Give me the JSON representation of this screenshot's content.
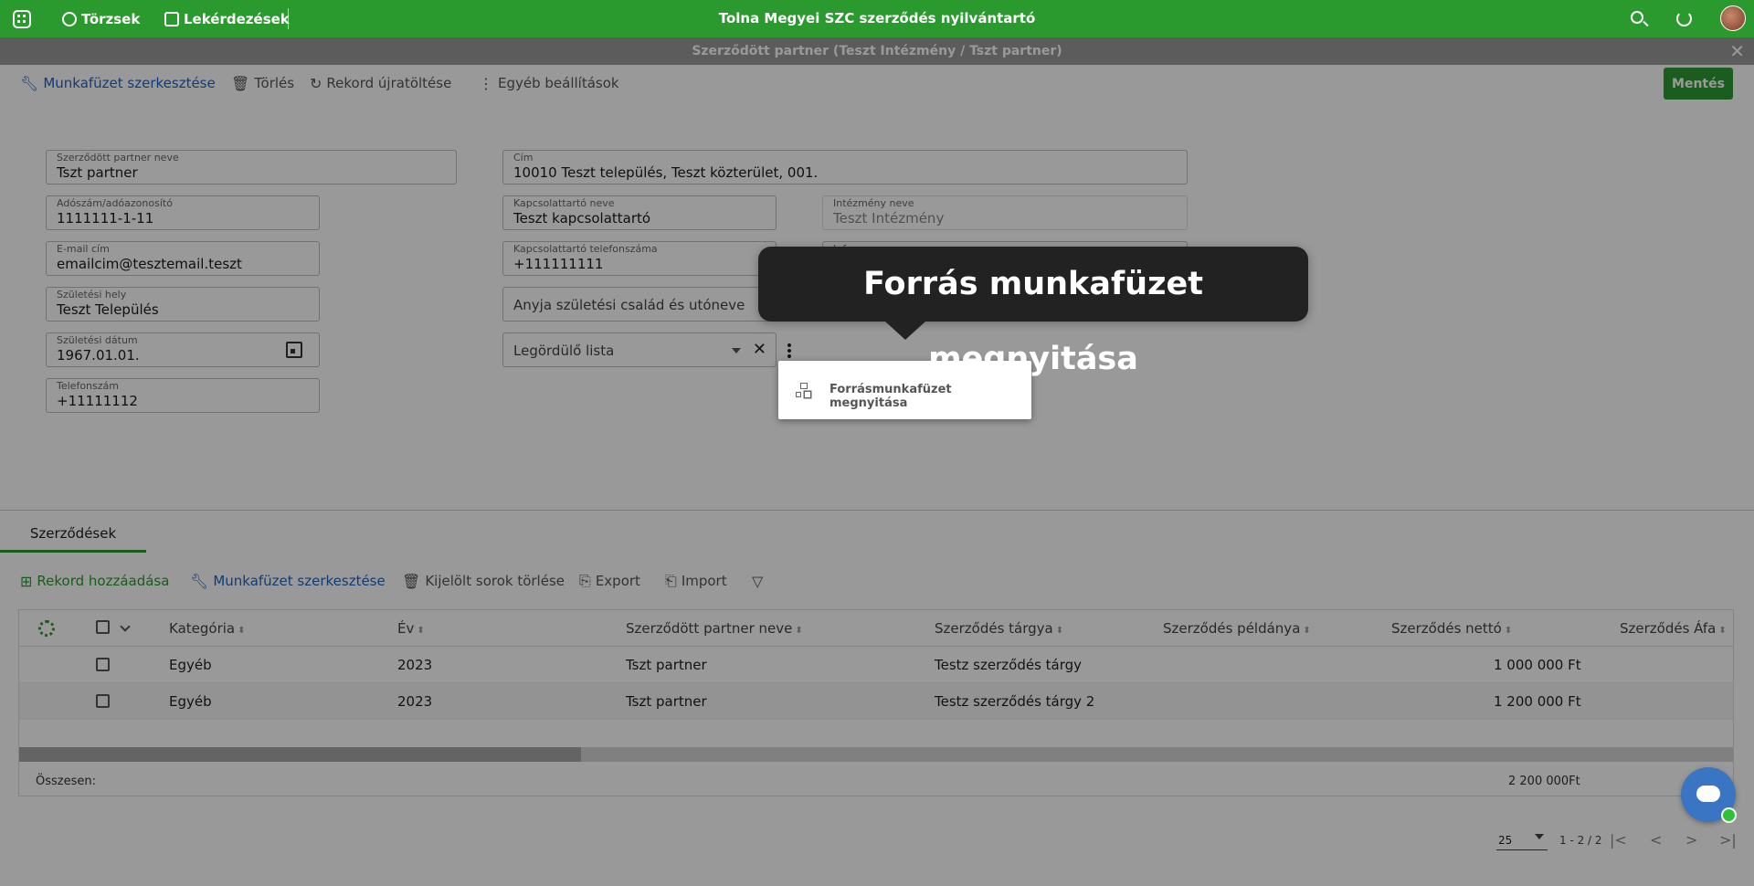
{
  "topbar": {
    "nav_items": [
      "Törzsek",
      "Lekérdezések"
    ],
    "app_title": "Tolna Megyei SZC szerződés nyilvántartó",
    "icons": [
      "apps-icon",
      "search-icon",
      "refresh-icon",
      "user-avatar"
    ]
  },
  "subheader": {
    "title": "Szerződött partner (Teszt Intézmény / Tszt partner)",
    "close": "✕"
  },
  "toolbar": {
    "edit_workbook": "Munkafüzet szerkesztése",
    "delete": "Törlés",
    "reload": "Rekord újratöltése",
    "more": "Egyéb beállítások",
    "save": "Mentés"
  },
  "form": {
    "partner_name": {
      "label": "Szerződött partner neve",
      "value": "Tszt partner"
    },
    "tax_id": {
      "label": "Adószám/adóazonosító",
      "value": "1111111-1-11"
    },
    "email": {
      "label": "E-mail cím",
      "value": "emailcim@tesztemail.teszt"
    },
    "birth_place": {
      "label": "Születési hely",
      "value": "Teszt Település"
    },
    "birth_date": {
      "label": "Születési dátum",
      "value": "1967.01.01."
    },
    "phone": {
      "label": "Telefonszám",
      "value": "+11111112"
    },
    "address": {
      "label": "Cím",
      "value": "10010 Teszt település, Teszt közterület, 001."
    },
    "contact_name": {
      "label": "Kapcsolattartó neve",
      "value": "Teszt kapcsolattartó"
    },
    "institution": {
      "label": "Intézmény neve",
      "value": "Teszt Intézmény"
    },
    "contact_phone": {
      "label": "Kapcsolattartó telefonszáma",
      "value": "+111111111"
    },
    "info": {
      "label": "Info"
    },
    "mother_name": {
      "placeholder": "Anyja születési család és utóneve"
    },
    "dropdown": {
      "placeholder": "Legördülő lista"
    }
  },
  "popup": {
    "item": "Forrásmunkafüzet megnyitása"
  },
  "tooltip": {
    "text": "Forrás munkafüzet megnyitása"
  },
  "tabs": [
    "Szerződések"
  ],
  "grid_toolbar": {
    "add": "Rekord hozzáadása",
    "edit_workbook": "Munkafüzet szerkesztése",
    "delete_selected": "Kijelölt sorok törlése",
    "export": "Export",
    "import": "Import"
  },
  "table": {
    "columns": [
      "Kategória",
      "Év",
      "Szerződött partner neve",
      "Szerződés tárgya",
      "Szerződés példánya",
      "Szerződés nettó",
      "Szerződés Áfa"
    ],
    "rows": [
      {
        "category": "Egyéb",
        "year": "2023",
        "partner": "Tszt partner",
        "subject": "Testz szerződés tárgy",
        "net": "1 000 000 Ft"
      },
      {
        "category": "Egyéb",
        "year": "2023",
        "partner": "Tszt partner",
        "subject": "Testz szerződés tárgy 2",
        "net": "1 200 000 Ft"
      }
    ],
    "footer_label": "Összesen:",
    "footer_total": "2 200 000Ft"
  },
  "pager": {
    "page_size": "25",
    "range": "1 - 2 / 2"
  },
  "colors": {
    "brand_green": "#2a9a2e",
    "link_blue": "#1e63c5",
    "tooltip_bg": "#222222"
  }
}
